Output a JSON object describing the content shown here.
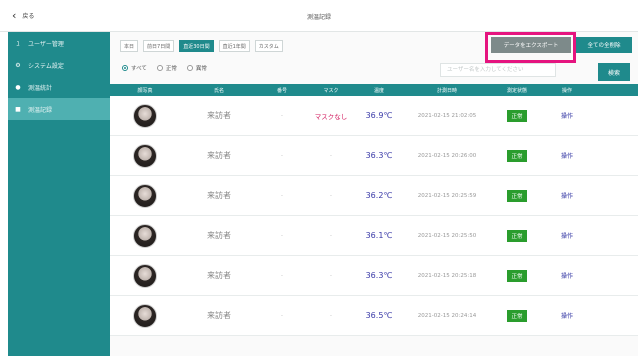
{
  "header": {
    "back_label": "戻る",
    "title": "測温記録"
  },
  "sidebar": {
    "items": [
      {
        "icon": "users-icon",
        "glyph": "ﾕ",
        "label": "ユーザー管理"
      },
      {
        "icon": "gear-icon",
        "glyph": "⚙",
        "label": "システム設定"
      },
      {
        "icon": "chart-icon",
        "glyph": "●",
        "label": "測温統計"
      },
      {
        "icon": "record-icon",
        "glyph": "■",
        "label": "測温記録"
      }
    ]
  },
  "filters": {
    "chips": [
      "本日",
      "前日7日間",
      "直近30日間",
      "直近1年間",
      "カスタム"
    ],
    "active_index": 2
  },
  "actions": {
    "export_label": "データをエクスポート",
    "delete_all_label": "全ての全削除"
  },
  "radio": {
    "options": [
      "すべて",
      "正常",
      "異常"
    ],
    "selected_index": 0
  },
  "search": {
    "placeholder": "ユーザー名を入力してください",
    "button_label": "検索"
  },
  "table": {
    "columns": [
      "顔写真",
      "氏名",
      "番号",
      "マスク",
      "温度",
      "計測日時",
      "測定状態",
      "操作"
    ],
    "rows": [
      {
        "name": "来訪者",
        "number": "-",
        "mask": "マスクなし",
        "temp": "36.9℃",
        "time": "2021-02-15 21:02:05",
        "status": "正常",
        "op": "操作"
      },
      {
        "name": "来訪者",
        "number": "-",
        "mask": "-",
        "temp": "36.3℃",
        "time": "2021-02-15 20:26:00",
        "status": "正常",
        "op": "操作"
      },
      {
        "name": "来訪者",
        "number": "-",
        "mask": "-",
        "temp": "36.2℃",
        "time": "2021-02-15 20:25:59",
        "status": "正常",
        "op": "操作"
      },
      {
        "name": "来訪者",
        "number": "-",
        "mask": "-",
        "temp": "36.1℃",
        "time": "2021-02-15 20:25:50",
        "status": "正常",
        "op": "操作"
      },
      {
        "name": "来訪者",
        "number": "-",
        "mask": "-",
        "temp": "36.3℃",
        "time": "2021-02-15 20:25:18",
        "status": "正常",
        "op": "操作"
      },
      {
        "name": "来訪者",
        "number": "-",
        "mask": "-",
        "temp": "36.5℃",
        "time": "2021-02-15 20:24:14",
        "status": "正常",
        "op": "操作"
      }
    ]
  },
  "colors": {
    "accent": "#1f8a8c",
    "highlight": "#e5147f",
    "status_ok": "#2a9d2d",
    "temp": "#3a3aa8",
    "mask_warn": "#d21b5e"
  }
}
